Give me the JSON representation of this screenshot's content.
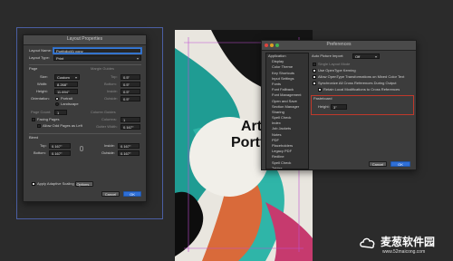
{
  "layout_dialog": {
    "title": "Layout Properties",
    "layout_name_label": "Layout Name:",
    "layout_name_value": "Portfolio(A) copy",
    "layout_type_label": "Layout Type:",
    "layout_type_value": "Print",
    "page_section": "Page",
    "size_label": "Size:",
    "size_value": "Custom",
    "width_label": "Width:",
    "width_value": "8.268\"",
    "height_label": "Height:",
    "height_value": "11.694\"",
    "orientation_label": "Orientation:",
    "portrait_label": "Portrait",
    "landscape_label": "Landscape",
    "page_count_label": "Page Count:",
    "page_count_value": "1",
    "facing_pages_label": "Facing Pages",
    "allow_odd_label": "Allow Odd Pages as Left",
    "margin_guides_section": "Margin Guides",
    "margin_labels": [
      "Top:",
      "Bottom:",
      "Inside:",
      "Outside:"
    ],
    "margin_values": [
      "0.5\"",
      "0.5\"",
      "0.5\"",
      "0.5\""
    ],
    "column_guides_section": "Column Guides",
    "columns_label": "Columns:",
    "columns_value": "1",
    "gutter_label": "Gutter Width:",
    "gutter_value": "0.167\"",
    "bleed_section": "Bleed",
    "bleed_labels": [
      "Top:",
      "Bottom:",
      "Inside:",
      "Outside:"
    ],
    "bleed_values": [
      "0.167\"",
      "0.167\"",
      "0.167\"",
      "0.167\""
    ],
    "adaptive_scaling_label": "Apply Adaptive Scaling",
    "options_label": "Options...",
    "cancel_label": "Cancel",
    "ok_label": "OK"
  },
  "artwork": {
    "title_line1": "Art",
    "title_line2": "Portfolio"
  },
  "preferences_dialog": {
    "title": "Preferences",
    "categories": [
      "Application",
      "Display",
      "Color Theme",
      "Key Shortcuts",
      "Input Settings",
      "Fonts",
      "Font Fallback",
      "Font Management",
      "Open and Save",
      "Section Manager",
      "Sharing",
      "Spell Check",
      "Index",
      "Job Jackets",
      "Notes",
      "PDF",
      "Placeholders",
      "Legacy PDF",
      "Redline",
      "Spell Check",
      "Tables",
      "Fraction/Price",
      "Project",
      "General"
    ],
    "selected_category": "General",
    "auto_picture_import_label": "Auto Picture Import:",
    "auto_picture_import_value": "Off",
    "options": [
      {
        "label": "Single Layout Mode",
        "checked": false
      },
      {
        "label": "Use OpenType Kerning",
        "checked": true
      },
      {
        "label": "Allow OpenType Transformations on Mixed Color Text",
        "checked": true
      },
      {
        "label": "Synchronize All Cross References During Output",
        "checked": true
      },
      {
        "label": "Retain Local Modifications to Cross References",
        "checked": true
      }
    ],
    "pasteboard_section": "Pasteboard",
    "height_label": "Height:",
    "height_value": "3\"",
    "cancel_label": "Cancel",
    "ok_label": "OK"
  },
  "watermark": {
    "brand": "麦葱软件园",
    "url": "www.52maicong.com"
  },
  "colors": {
    "accent_blue": "#2f6fd6",
    "teal": "#2fb5a8",
    "highlight_red": "#c0392b"
  }
}
